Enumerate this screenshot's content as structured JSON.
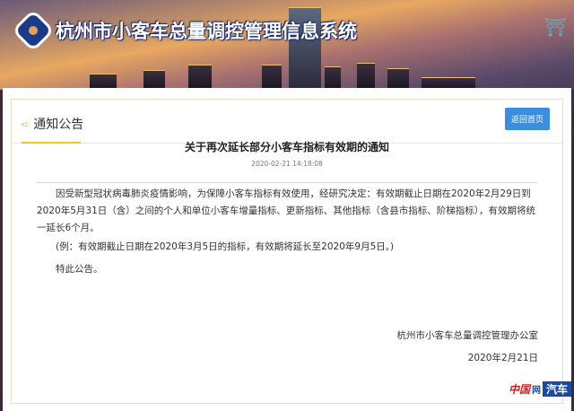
{
  "header": {
    "system_title": "杭州市小客车总量调控管理信息系统",
    "logo_icon": "xiaokeche-logo",
    "emblem_icon": "hangzhou-emblem"
  },
  "section": {
    "title": "通知公告",
    "back_button": "返回首页"
  },
  "notice": {
    "title": "关于再次延长部分小客车指标有效期的通知",
    "timestamp": "2020-02-21 14:18:08",
    "paragraph1": "因受新型冠状病毒肺炎疫情影响，为保障小客车指标有效使用，经研究决定：有效期截止日期在2020年2月29日到2020年5月31日（含）之间的个人和单位小客车增量指标、更新指标、其他指标（含县市指标、阶梯指标），有效期将统一延长6个月。",
    "paragraph2": "(例：有效期截止日期在2020年3月5日的指标，有效期将延长至2020年9月5日。)",
    "paragraph3": "特此公告。",
    "signature": "杭州市小客车总量调控管理办公室",
    "date": "2020年2月21日"
  },
  "watermark": {
    "part1": "中国",
    "part2": "网",
    "part3": "汽车"
  },
  "colors": {
    "button": "#3a8ee0",
    "accent_underline": "#e8c830",
    "title_text": "#ffffff"
  }
}
